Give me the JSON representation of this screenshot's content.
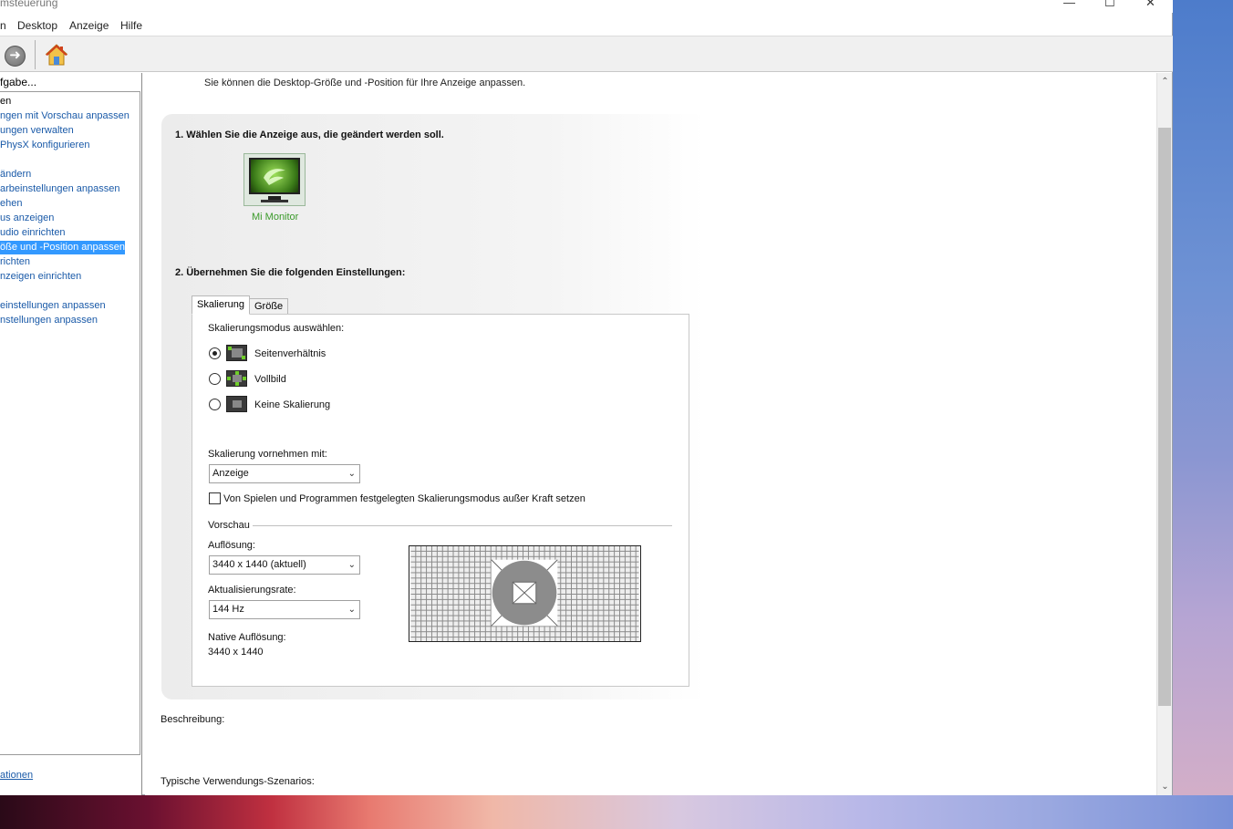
{
  "window": {
    "title": "msteuerung",
    "minimize": "—",
    "maximize": "☐",
    "close": "✕"
  },
  "menu": [
    "n",
    "Desktop",
    "Anzeige",
    "Hilfe"
  ],
  "sidebar": {
    "task_label": "fgabe...",
    "items": [
      {
        "label": "en",
        "style": "plain"
      },
      {
        "label": "ngen mit Vorschau anpassen",
        "style": "link"
      },
      {
        "label": "ungen verwalten",
        "style": "link"
      },
      {
        "label": "PhysX konfigurieren",
        "style": "link"
      },
      {
        "label": "",
        "style": "spacer"
      },
      {
        "label": "ändern",
        "style": "link"
      },
      {
        "label": "arbeinstellungen anpassen",
        "style": "link"
      },
      {
        "label": "ehen",
        "style": "link"
      },
      {
        "label": "us anzeigen",
        "style": "link"
      },
      {
        "label": "udio einrichten",
        "style": "link"
      },
      {
        "label": "öße und -Position anpassen",
        "style": "selected"
      },
      {
        "label": "richten",
        "style": "link"
      },
      {
        "label": "nzeigen einrichten",
        "style": "link"
      },
      {
        "label": "",
        "style": "spacer"
      },
      {
        "label": "einstellungen anpassen",
        "style": "link"
      },
      {
        "label": "nstellungen anpassen",
        "style": "link"
      }
    ],
    "footer_link": "ationen"
  },
  "content": {
    "intro": "Sie können die Desktop-Größe und -Position für Ihre Anzeige anpassen.",
    "step1_title": "1. Wählen Sie die Anzeige aus, die geändert werden soll.",
    "monitor_label": "Mi Monitor",
    "step2_title": "2. Übernehmen Sie die folgenden Einstellungen:",
    "tabs": {
      "scaling": "Skalierung",
      "size": "Größe"
    },
    "scaling_mode_label": "Skalierungsmodus auswählen:",
    "modes": [
      {
        "label": "Seitenverhältnis",
        "selected": true
      },
      {
        "label": "Vollbild",
        "selected": false
      },
      {
        "label": "Keine Skalierung",
        "selected": false
      }
    ],
    "perform_with_label": "Skalierung vornehmen mit:",
    "perform_with_value": "Anzeige",
    "override_label": "Von Spielen und Programmen festgelegten Skalierungsmodus außer Kraft setzen",
    "override_checked": false,
    "preview_group": "Vorschau",
    "resolution_label": "Auflösung:",
    "resolution_value": "3440 x 1440 (aktuell)",
    "refresh_label": "Aktualisierungsrate:",
    "refresh_value": "144 Hz",
    "native_label": "Native Auflösung:",
    "native_value": "3440 x 1440",
    "description_label": "Beschreibung:",
    "scenarios_label": "Typische Verwendungs-Szenarios:"
  },
  "colors": {
    "link": "#1a5aa8",
    "selected_bg": "#3399ff",
    "nvidia_green": "#76b900",
    "monitor_label": "#3a9a2a"
  },
  "icons": {
    "forward": "forward-arrow-icon",
    "home": "home-icon",
    "scroll_up": "chevron-up-icon",
    "scroll_down": "chevron-down-icon"
  }
}
